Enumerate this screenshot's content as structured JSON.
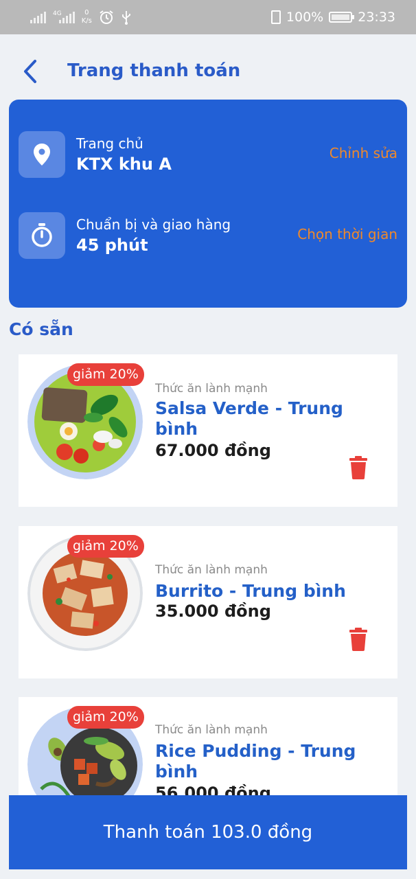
{
  "status_bar": {
    "network_tag": "4G",
    "speed_value": "0",
    "speed_unit": "K/s",
    "battery": "100%",
    "time": "23:33"
  },
  "header": {
    "title": "Trang thanh toán"
  },
  "delivery": {
    "address_label": "Trang chủ",
    "address_value": "KTX khu A",
    "address_action": "Chỉnh sửa",
    "time_label": "Chuẩn bị và giao hàng",
    "time_value": "45 phút",
    "time_action": "Chọn thời gian"
  },
  "section_title": "Có sẵn",
  "items": [
    {
      "badge": "giảm 20%",
      "category": "Thức ăn lành mạnh",
      "name": "Salsa Verde - Trung bình",
      "price": "67.000 đồng"
    },
    {
      "badge": "giảm 20%",
      "category": "Thức ăn lành mạnh",
      "name": "Burrito - Trung bình",
      "price": "35.000 đồng"
    },
    {
      "badge": "giảm 20%",
      "category": "Thức ăn lành mạnh",
      "name": "Rice Pudding - Trung bình",
      "price": "56.000 đồng"
    }
  ],
  "checkout_label": "Thanh toán 103.0 đồng",
  "colors": {
    "primary": "#2260d6",
    "accent": "#f0892a",
    "badge": "#e8403a",
    "title": "#2a5bc8"
  },
  "icons": [
    "back-arrow-icon",
    "location-pin-icon",
    "stopwatch-icon",
    "trash-icon",
    "alarm-icon",
    "usb-icon",
    "vibrate-icon",
    "battery-icon",
    "signal-icon"
  ]
}
